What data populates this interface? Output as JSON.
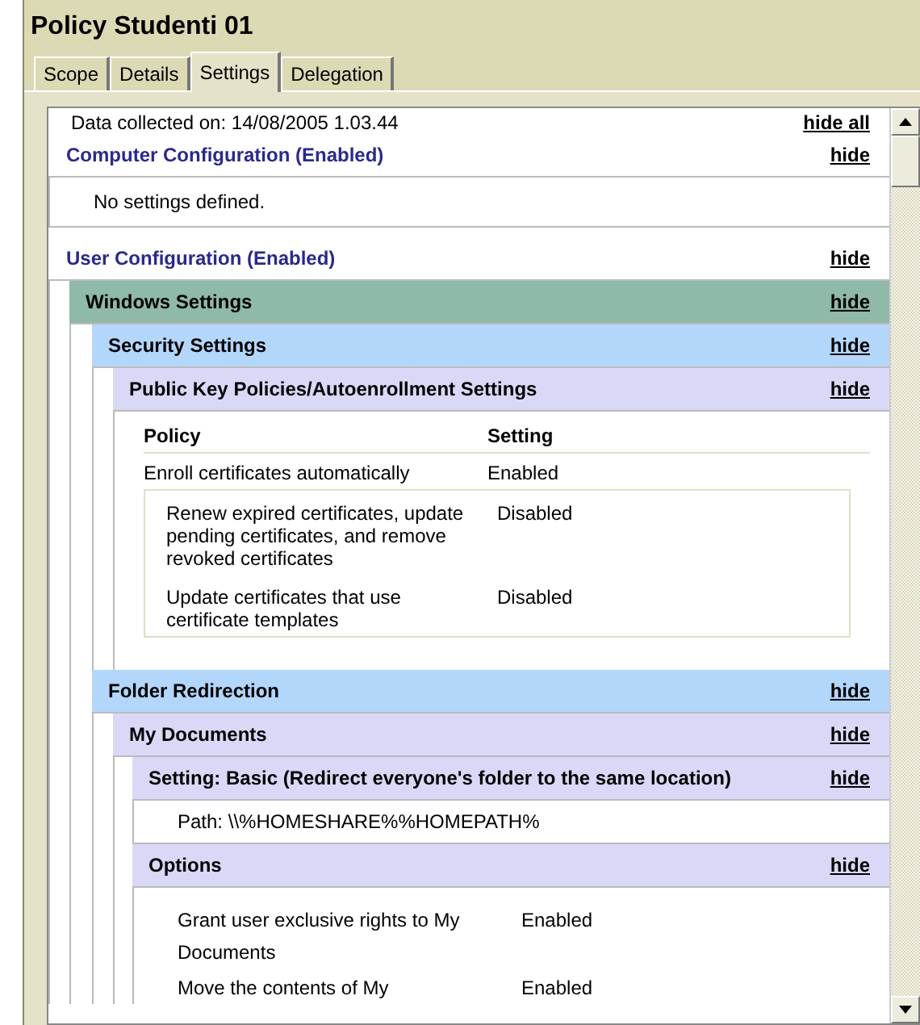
{
  "window": {
    "title": "Policy Studenti 01"
  },
  "tabs": [
    {
      "label": "Scope",
      "selected": false
    },
    {
      "label": "Details",
      "selected": false
    },
    {
      "label": "Settings",
      "selected": true
    },
    {
      "label": "Delegation",
      "selected": false
    }
  ],
  "report": {
    "data_collected": "Data collected on: 14/08/2005 1.03.44",
    "hide_all": "hide all",
    "sections": [
      {
        "title": "Computer Configuration (Enabled)",
        "hide": "hide",
        "content": {
          "kind": "note",
          "text": "No settings defined."
        }
      },
      {
        "title": "User Configuration (Enabled)",
        "hide": "hide",
        "children": [
          {
            "title": "Windows Settings",
            "hide": "hide",
            "children": [
              {
                "title": "Security Settings",
                "hide": "hide",
                "children": [
                  {
                    "title": "Public Key Policies/Autoenrollment Settings",
                    "hide": "hide",
                    "content": {
                      "kind": "policy_table",
                      "columns": [
                        "Policy",
                        "Setting"
                      ],
                      "rows": [
                        {
                          "policy": "Enroll certificates automatically",
                          "setting": "Enabled",
                          "children": [
                            {
                              "policy": "Renew expired certificates, update pending certificates, and remove revoked certificates",
                              "setting": "Disabled"
                            },
                            {
                              "policy": "Update certificates that use certificate templates",
                              "setting": "Disabled"
                            }
                          ]
                        }
                      ]
                    }
                  }
                ]
              },
              {
                "title": "Folder Redirection",
                "hide": "hide",
                "children": [
                  {
                    "title": "My Documents",
                    "hide": "hide",
                    "children": [
                      {
                        "title": "Setting: Basic (Redirect everyone's folder to the same location)",
                        "hide": "hide",
                        "content": {
                          "kind": "path",
                          "text": "Path: \\\\%HOMESHARE%%HOMEPATH%"
                        }
                      },
                      {
                        "title": "Options",
                        "hide": "hide",
                        "content": {
                          "kind": "options",
                          "rows": [
                            {
                              "policy": "Grant user exclusive rights to My Documents",
                              "setting": "Enabled"
                            },
                            {
                              "policy": "Move the contents of My",
                              "setting": "Enabled"
                            }
                          ]
                        }
                      }
                    ]
                  }
                ]
              }
            ]
          }
        ]
      }
    ]
  }
}
